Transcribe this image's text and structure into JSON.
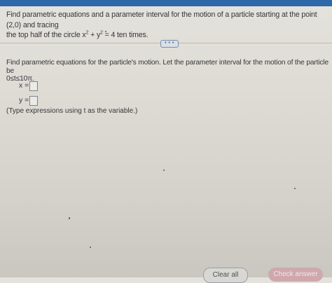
{
  "question": {
    "line1_prefix": "Find parametric equations and a parameter interval for the motion of a particle starting at the point (2,0) and tracing",
    "line2_prefix": "the top half of the circle x",
    "sup1": "2",
    "plus_y": " + y",
    "sup2": "2",
    "line2_suffix": " = 4 ten times."
  },
  "more_button_label": "• • •",
  "instruction": {
    "line1": "Find parametric equations for the particle's motion. Let the parameter interval for the motion of the particle be",
    "line2": "0≤t≤10π."
  },
  "equations": {
    "x_label": "x =",
    "y_label": "y ="
  },
  "hint": "(Type expressions using t as the variable.)",
  "buttons": {
    "clear": "Clear all",
    "check": "Check answer"
  }
}
